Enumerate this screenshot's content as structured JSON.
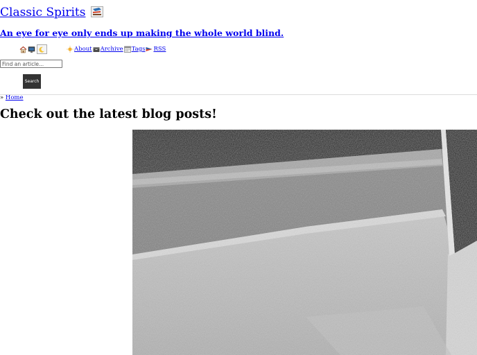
{
  "site": {
    "title": "Classic Spirits",
    "tagline": "An eye for eye only ends up making the whole world blind."
  },
  "theme_toggle": {
    "icons": [
      "house-icon",
      "monitor-icon",
      "moon-icon"
    ]
  },
  "nav": {
    "items": [
      {
        "label": "About",
        "icon": "sun-icon"
      },
      {
        "label": "Archive",
        "icon": "box-icon"
      },
      {
        "label": "Tags",
        "icon": "calendar-icon"
      },
      {
        "label": "RSS",
        "icon": "flag-icon"
      }
    ]
  },
  "search": {
    "placeholder": "Find an article...",
    "button_label": "Search"
  },
  "breadcrumb": {
    "separator": "»",
    "home_label": "Home"
  },
  "main": {
    "heading": "Check out the latest blog posts!"
  },
  "colors": {
    "link": "#0000ee",
    "button_bg": "#333333",
    "divider": "#dcdcdc"
  }
}
